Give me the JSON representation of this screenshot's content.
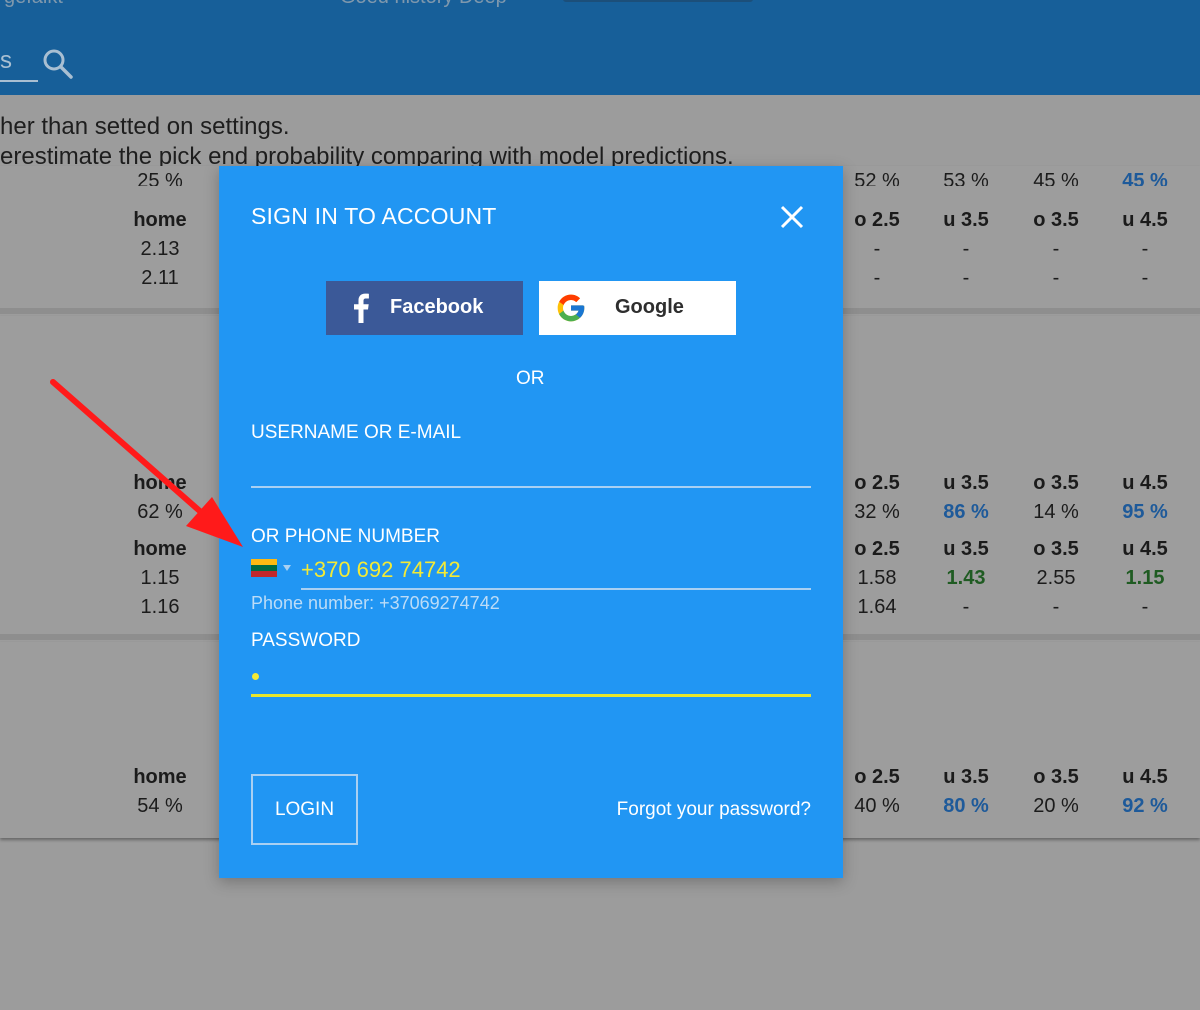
{
  "background": {
    "nav": {
      "left_fragment": "gefaikt",
      "dash": "-",
      "center_text": "Goed history Deep",
      "search_fragment": "s"
    },
    "notice": {
      "line1": "her than setted on settings.",
      "line2": "erestimate the pick end probability comparing with model predictions."
    },
    "table1": {
      "partial_top": [
        "25 %",
        "52 %",
        "53 %",
        "45 %",
        "45 %"
      ],
      "headers": [
        "home",
        "o 2.5",
        "u 3.5",
        "o 3.5",
        "u 4.5"
      ],
      "row1": [
        "2.13",
        "-",
        "-",
        "-",
        "-"
      ],
      "row2": [
        "2.11",
        "-",
        "-",
        "-",
        "-"
      ]
    },
    "table2": {
      "headers1": [
        "home",
        "o 2.5",
        "u 3.5",
        "o 3.5",
        "u 4.5"
      ],
      "probs": [
        "62 %",
        "32 %",
        "86 %",
        "14 %",
        "95 %"
      ],
      "headers2": [
        "home",
        "o 2.5",
        "u 3.5",
        "o 3.5",
        "u 4.5"
      ],
      "row1": [
        "1.15",
        "1.58",
        "1.43",
        "2.55",
        "1.15"
      ],
      "row2": [
        "1.16",
        "1.64",
        "-",
        "-",
        "-"
      ]
    },
    "table3": {
      "headers": [
        "home",
        "o 2.5",
        "u 3.5",
        "o 3.5",
        "u 4.5"
      ],
      "probs": [
        "54 %",
        "40 %",
        "80 %",
        "20 %",
        "92 %"
      ]
    }
  },
  "modal": {
    "title": "SIGN IN TO ACCOUNT",
    "close_icon": "close-icon",
    "facebook_label": "Facebook",
    "google_label": "Google",
    "or_text": "OR",
    "username_label": "USERNAME OR E-MAIL",
    "username_value": "",
    "phone_label": "OR PHONE NUMBER",
    "phone_country": "Lithuania",
    "phone_value": "+370 692 74742",
    "phone_hint": "Phone number: +37069274742",
    "password_label": "PASSWORD",
    "login_label": "LOGIN",
    "forgot_label": "Forgot your password?"
  },
  "colors": {
    "modal_bg": "#2196f3",
    "topbar": "#175f99",
    "accent_yellow": "#f3ea36",
    "facebook": "#3b5998",
    "annotation_arrow": "#ff1a1a"
  }
}
